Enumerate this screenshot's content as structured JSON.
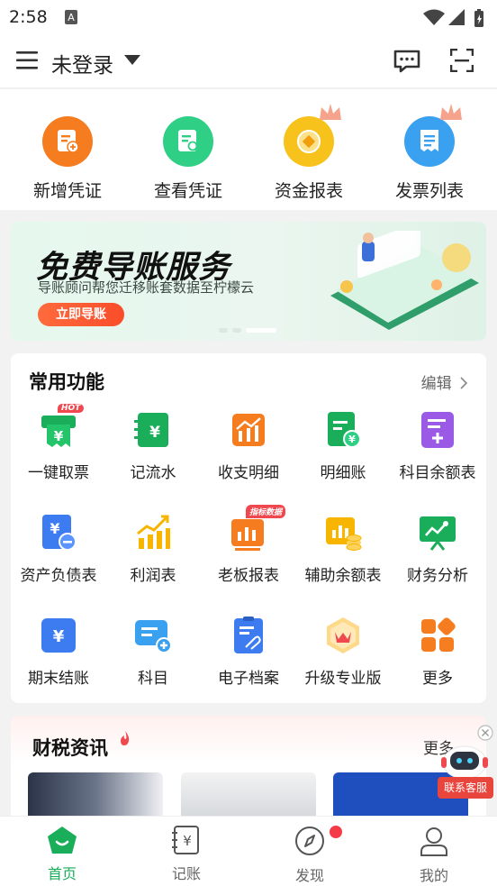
{
  "status_bar": {
    "time": "2:58"
  },
  "header": {
    "title": "未登录"
  },
  "shortcuts": [
    {
      "label": "新增凭证",
      "icon": "add-voucher-icon",
      "color": "#f57c1f"
    },
    {
      "label": "查看凭证",
      "icon": "view-voucher-icon",
      "color": "#2fcf85"
    },
    {
      "label": "资金报表",
      "icon": "fund-report-icon",
      "color": "#f7c21b"
    },
    {
      "label": "发票列表",
      "icon": "invoice-list-icon",
      "color": "#3aa0f0"
    }
  ],
  "banner": {
    "headline": "免费导账服务",
    "subtext": "导账顾问帮您迁移账套数据至柠檬云",
    "cta": "立即导账"
  },
  "common_functions": {
    "title": "常用功能",
    "edit": "编辑",
    "items": [
      {
        "label": "一键取票",
        "badge": "HOT",
        "icon": "get-invoice-icon"
      },
      {
        "label": "记流水",
        "icon": "cash-journal-icon"
      },
      {
        "label": "收支明细",
        "icon": "income-expense-icon"
      },
      {
        "label": "明细账",
        "icon": "detail-ledger-icon"
      },
      {
        "label": "科目余额表",
        "icon": "account-balance-icon"
      },
      {
        "label": "资产负债表",
        "icon": "balance-sheet-icon"
      },
      {
        "label": "利润表",
        "icon": "profit-statement-icon"
      },
      {
        "label": "老板报表",
        "badge": "指标数据",
        "icon": "boss-report-icon"
      },
      {
        "label": "辅助余额表",
        "icon": "auxiliary-balance-icon"
      },
      {
        "label": "财务分析",
        "icon": "financial-analysis-icon"
      },
      {
        "label": "期末结账",
        "icon": "period-close-icon"
      },
      {
        "label": "科目",
        "icon": "subjects-icon"
      },
      {
        "label": "电子档案",
        "icon": "e-archive-icon"
      },
      {
        "label": "升级专业版",
        "icon": "upgrade-pro-icon"
      },
      {
        "label": "更多",
        "icon": "more-grid-icon"
      }
    ]
  },
  "news": {
    "title": "财税资讯",
    "more": "更多"
  },
  "customer_service": {
    "label": "联系客服"
  },
  "tabs": [
    {
      "label": "首页",
      "active": true,
      "icon": "home-icon"
    },
    {
      "label": "记账",
      "icon": "bookkeeping-icon"
    },
    {
      "label": "发现",
      "icon": "discover-compass-icon",
      "dot": true
    },
    {
      "label": "我的",
      "icon": "profile-icon"
    }
  ],
  "colors": {
    "brand_green": "#1aad5a",
    "red_dot": "#f53b47"
  }
}
